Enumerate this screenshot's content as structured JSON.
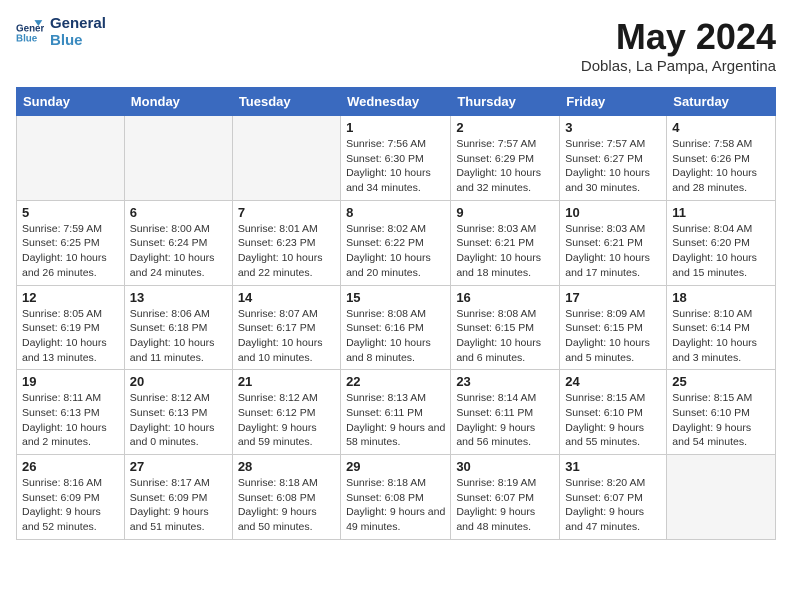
{
  "logo": {
    "line1": "General",
    "line2": "Blue"
  },
  "title": "May 2024",
  "subtitle": "Doblas, La Pampa, Argentina",
  "days_header": [
    "Sunday",
    "Monday",
    "Tuesday",
    "Wednesday",
    "Thursday",
    "Friday",
    "Saturday"
  ],
  "weeks": [
    [
      {
        "day": "",
        "sunrise": "",
        "sunset": "",
        "daylight": ""
      },
      {
        "day": "",
        "sunrise": "",
        "sunset": "",
        "daylight": ""
      },
      {
        "day": "",
        "sunrise": "",
        "sunset": "",
        "daylight": ""
      },
      {
        "day": "1",
        "sunrise": "Sunrise: 7:56 AM",
        "sunset": "Sunset: 6:30 PM",
        "daylight": "Daylight: 10 hours and 34 minutes."
      },
      {
        "day": "2",
        "sunrise": "Sunrise: 7:57 AM",
        "sunset": "Sunset: 6:29 PM",
        "daylight": "Daylight: 10 hours and 32 minutes."
      },
      {
        "day": "3",
        "sunrise": "Sunrise: 7:57 AM",
        "sunset": "Sunset: 6:27 PM",
        "daylight": "Daylight: 10 hours and 30 minutes."
      },
      {
        "day": "4",
        "sunrise": "Sunrise: 7:58 AM",
        "sunset": "Sunset: 6:26 PM",
        "daylight": "Daylight: 10 hours and 28 minutes."
      }
    ],
    [
      {
        "day": "5",
        "sunrise": "Sunrise: 7:59 AM",
        "sunset": "Sunset: 6:25 PM",
        "daylight": "Daylight: 10 hours and 26 minutes."
      },
      {
        "day": "6",
        "sunrise": "Sunrise: 8:00 AM",
        "sunset": "Sunset: 6:24 PM",
        "daylight": "Daylight: 10 hours and 24 minutes."
      },
      {
        "day": "7",
        "sunrise": "Sunrise: 8:01 AM",
        "sunset": "Sunset: 6:23 PM",
        "daylight": "Daylight: 10 hours and 22 minutes."
      },
      {
        "day": "8",
        "sunrise": "Sunrise: 8:02 AM",
        "sunset": "Sunset: 6:22 PM",
        "daylight": "Daylight: 10 hours and 20 minutes."
      },
      {
        "day": "9",
        "sunrise": "Sunrise: 8:03 AM",
        "sunset": "Sunset: 6:21 PM",
        "daylight": "Daylight: 10 hours and 18 minutes."
      },
      {
        "day": "10",
        "sunrise": "Sunrise: 8:03 AM",
        "sunset": "Sunset: 6:21 PM",
        "daylight": "Daylight: 10 hours and 17 minutes."
      },
      {
        "day": "11",
        "sunrise": "Sunrise: 8:04 AM",
        "sunset": "Sunset: 6:20 PM",
        "daylight": "Daylight: 10 hours and 15 minutes."
      }
    ],
    [
      {
        "day": "12",
        "sunrise": "Sunrise: 8:05 AM",
        "sunset": "Sunset: 6:19 PM",
        "daylight": "Daylight: 10 hours and 13 minutes."
      },
      {
        "day": "13",
        "sunrise": "Sunrise: 8:06 AM",
        "sunset": "Sunset: 6:18 PM",
        "daylight": "Daylight: 10 hours and 11 minutes."
      },
      {
        "day": "14",
        "sunrise": "Sunrise: 8:07 AM",
        "sunset": "Sunset: 6:17 PM",
        "daylight": "Daylight: 10 hours and 10 minutes."
      },
      {
        "day": "15",
        "sunrise": "Sunrise: 8:08 AM",
        "sunset": "Sunset: 6:16 PM",
        "daylight": "Daylight: 10 hours and 8 minutes."
      },
      {
        "day": "16",
        "sunrise": "Sunrise: 8:08 AM",
        "sunset": "Sunset: 6:15 PM",
        "daylight": "Daylight: 10 hours and 6 minutes."
      },
      {
        "day": "17",
        "sunrise": "Sunrise: 8:09 AM",
        "sunset": "Sunset: 6:15 PM",
        "daylight": "Daylight: 10 hours and 5 minutes."
      },
      {
        "day": "18",
        "sunrise": "Sunrise: 8:10 AM",
        "sunset": "Sunset: 6:14 PM",
        "daylight": "Daylight: 10 hours and 3 minutes."
      }
    ],
    [
      {
        "day": "19",
        "sunrise": "Sunrise: 8:11 AM",
        "sunset": "Sunset: 6:13 PM",
        "daylight": "Daylight: 10 hours and 2 minutes."
      },
      {
        "day": "20",
        "sunrise": "Sunrise: 8:12 AM",
        "sunset": "Sunset: 6:13 PM",
        "daylight": "Daylight: 10 hours and 0 minutes."
      },
      {
        "day": "21",
        "sunrise": "Sunrise: 8:12 AM",
        "sunset": "Sunset: 6:12 PM",
        "daylight": "Daylight: 9 hours and 59 minutes."
      },
      {
        "day": "22",
        "sunrise": "Sunrise: 8:13 AM",
        "sunset": "Sunset: 6:11 PM",
        "daylight": "Daylight: 9 hours and 58 minutes."
      },
      {
        "day": "23",
        "sunrise": "Sunrise: 8:14 AM",
        "sunset": "Sunset: 6:11 PM",
        "daylight": "Daylight: 9 hours and 56 minutes."
      },
      {
        "day": "24",
        "sunrise": "Sunrise: 8:15 AM",
        "sunset": "Sunset: 6:10 PM",
        "daylight": "Daylight: 9 hours and 55 minutes."
      },
      {
        "day": "25",
        "sunrise": "Sunrise: 8:15 AM",
        "sunset": "Sunset: 6:10 PM",
        "daylight": "Daylight: 9 hours and 54 minutes."
      }
    ],
    [
      {
        "day": "26",
        "sunrise": "Sunrise: 8:16 AM",
        "sunset": "Sunset: 6:09 PM",
        "daylight": "Daylight: 9 hours and 52 minutes."
      },
      {
        "day": "27",
        "sunrise": "Sunrise: 8:17 AM",
        "sunset": "Sunset: 6:09 PM",
        "daylight": "Daylight: 9 hours and 51 minutes."
      },
      {
        "day": "28",
        "sunrise": "Sunrise: 8:18 AM",
        "sunset": "Sunset: 6:08 PM",
        "daylight": "Daylight: 9 hours and 50 minutes."
      },
      {
        "day": "29",
        "sunrise": "Sunrise: 8:18 AM",
        "sunset": "Sunset: 6:08 PM",
        "daylight": "Daylight: 9 hours and 49 minutes."
      },
      {
        "day": "30",
        "sunrise": "Sunrise: 8:19 AM",
        "sunset": "Sunset: 6:07 PM",
        "daylight": "Daylight: 9 hours and 48 minutes."
      },
      {
        "day": "31",
        "sunrise": "Sunrise: 8:20 AM",
        "sunset": "Sunset: 6:07 PM",
        "daylight": "Daylight: 9 hours and 47 minutes."
      },
      {
        "day": "",
        "sunrise": "",
        "sunset": "",
        "daylight": ""
      }
    ]
  ]
}
